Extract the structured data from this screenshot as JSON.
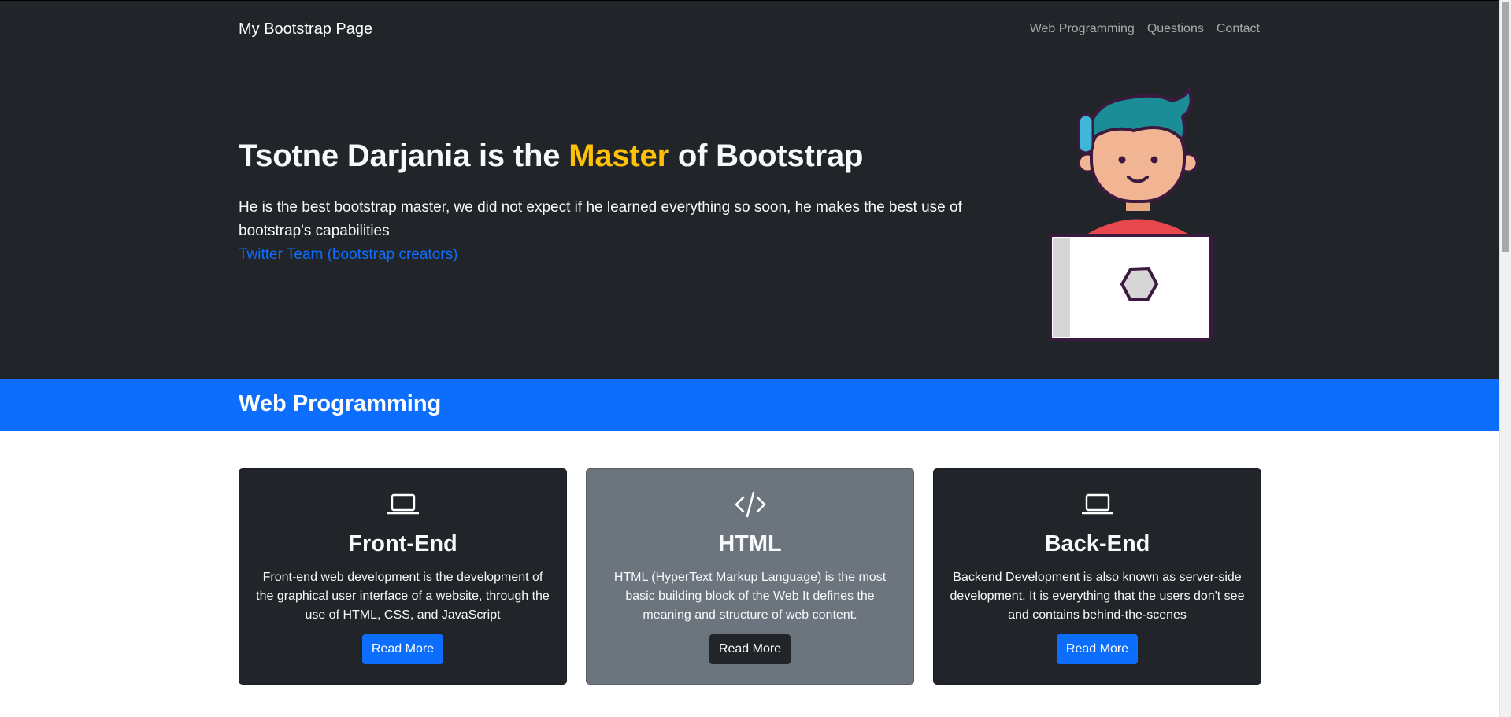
{
  "navbar": {
    "brand": "My Bootstrap Page",
    "links": [
      "Web Programming",
      "Questions",
      "Contact"
    ]
  },
  "hero": {
    "title_before": "Tsotne Darjania is the ",
    "title_accent": "Master",
    "title_after": " of Bootstrap",
    "lead": "He is the best bootstrap master, we did not expect if he learned everything so soon, he makes the best use of bootstrap's capabilities",
    "link": "Twitter Team (bootstrap creators)",
    "illustration": "developer-with-laptop-illustration"
  },
  "section": {
    "title": "Web Programming"
  },
  "cards": [
    {
      "icon": "laptop-icon",
      "title": "Front-End",
      "text": "Front-end web development is the development of the graphical user interface of a website, through the use of HTML, CSS, and JavaScript",
      "button": "Read More"
    },
    {
      "icon": "code-icon",
      "title": "HTML",
      "text": "HTML (HyperText Markup Language) is the most basic building block of the Web It defines the meaning and structure of web content.",
      "button": "Read More"
    },
    {
      "icon": "laptop-icon",
      "title": "Back-End",
      "text": "Backend Development is also known as server-side development. It is everything that the users don't see and contains behind-the-scenes",
      "button": "Read More"
    }
  ],
  "colors": {
    "dark": "#212529",
    "primary": "#0d6efd",
    "warning": "#ffc107",
    "secondary": "#6c757d"
  }
}
